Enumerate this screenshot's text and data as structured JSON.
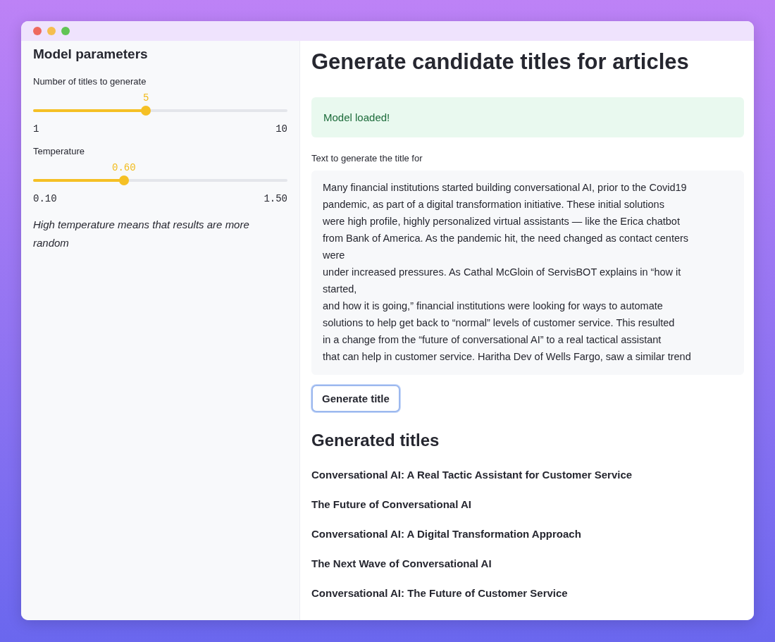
{
  "window": {
    "controls": [
      {
        "color": "#ee6a5f"
      },
      {
        "color": "#f5be4f"
      },
      {
        "color": "#61c454"
      }
    ]
  },
  "sidebar": {
    "title": "Model parameters",
    "sliders": [
      {
        "label": "Number of titles to generate",
        "value": "5",
        "min": "1",
        "max": "10",
        "level": 0.444
      },
      {
        "label": "Temperature",
        "value": "0.60",
        "min": "0.10",
        "max": "1.50",
        "level": 0.357
      }
    ],
    "note": "High temperature means that results are more random"
  },
  "main": {
    "title": "Generate candidate titles for articles",
    "alert": {
      "kind": "success",
      "text": "Model loaded!"
    },
    "text_field": {
      "label": "Text to generate the title for",
      "value": "Many financial institutions started building conversational AI, prior to the Covid19\npandemic, as part of a digital transformation initiative. These initial solutions\nwere high profile, highly personalized virtual assistants — like the Erica chatbot\nfrom Bank of America. As the pandemic hit, the need changed as contact centers\nwere\nunder increased pressures. As Cathal McGloin of ServisBOT explains in “how it\nstarted,\nand how it is going,” financial institutions were looking for ways to automate\nsolutions to help get back to “normal” levels of customer service. This resulted\nin a change from the “future of conversational AI” to a real tactical assistant\nthat can help in customer service. Haritha Dev of Wells Fargo, saw a similar trend"
    },
    "button": {
      "label": "Generate title",
      "focused": true
    },
    "results_heading": "Generated titles",
    "results": [
      "Conversational AI: A Real Tactic Assistant for Customer Service",
      "The Future of Conversational AI",
      "Conversational AI: A Digital Transformation Approach",
      "The Next Wave of Conversational AI",
      "Conversational AI: The Future of Customer Service"
    ]
  }
}
